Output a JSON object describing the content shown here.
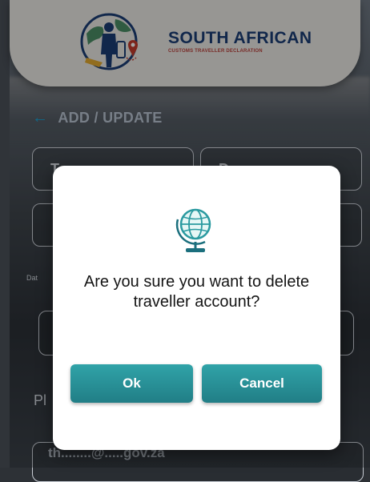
{
  "header": {
    "brand_title": "SOUTH AFRICAN",
    "brand_subtitle": "CUSTOMS TRAVELLER DECLARATION"
  },
  "section": {
    "back_icon": "arrow-left-icon",
    "title": "ADD / UPDATE"
  },
  "form": {
    "field1_partial": "T",
    "field2_partial": "D",
    "small_label_partial": "Dat",
    "phone_label_partial": "Pl",
    "email_partial": "th........@.....gov.za"
  },
  "dialog": {
    "icon": "globe-icon",
    "message": "Are you sure you want to delete traveller account?",
    "ok_label": "Ok",
    "cancel_label": "Cancel"
  },
  "colors": {
    "brand_blue": "#1b3d74",
    "brand_red": "#b8423c",
    "button_teal": "#2a8f96",
    "back_arrow": "#1b9fd0"
  }
}
